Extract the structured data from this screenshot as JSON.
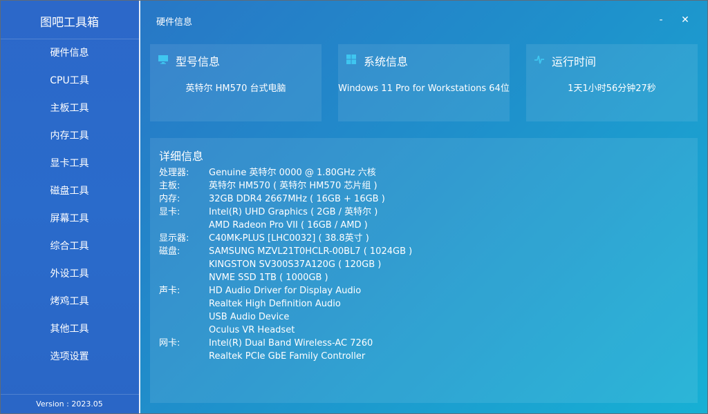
{
  "app": {
    "title": "图吧工具箱",
    "version": "Version : 2023.05"
  },
  "sidebar": {
    "items": [
      {
        "label": "硬件信息"
      },
      {
        "label": "CPU工具"
      },
      {
        "label": "主板工具"
      },
      {
        "label": "内存工具"
      },
      {
        "label": "显卡工具"
      },
      {
        "label": "磁盘工具"
      },
      {
        "label": "屏幕工具"
      },
      {
        "label": "综合工具"
      },
      {
        "label": "外设工具"
      },
      {
        "label": "烤鸡工具"
      },
      {
        "label": "其他工具"
      },
      {
        "label": "选项设置"
      }
    ]
  },
  "titlebar": {
    "page": "硬件信息",
    "minimize": "-",
    "close": "✕"
  },
  "cards": {
    "model": {
      "title": "型号信息",
      "value": "英特尔 HM570 台式电脑",
      "icon": "monitor-icon"
    },
    "system": {
      "title": "系统信息",
      "value": "Windows 11 Pro for Workstations 64位",
      "icon": "windows-icon"
    },
    "uptime": {
      "title": "运行时间",
      "value": "1天1小时56分钟27秒",
      "icon": "pulse-icon"
    }
  },
  "detail": {
    "title": "详细信息",
    "rows": [
      {
        "label": "处理器:",
        "values": [
          "Genuine 英特尔 0000 @ 1.80GHz 六核"
        ]
      },
      {
        "label": "主板:",
        "values": [
          "英特尔 HM570 ( 英特尔 HM570 芯片组 )"
        ]
      },
      {
        "label": "内存:",
        "values": [
          "32GB DDR4 2667MHz ( 16GB + 16GB )"
        ]
      },
      {
        "label": "显卡:",
        "values": [
          "Intel(R) UHD Graphics ( 2GB / 英特尔 )",
          "AMD Radeon Pro VII ( 16GB / AMD )"
        ]
      },
      {
        "label": "显示器:",
        "values": [
          "C40MK-PLUS [LHC0032] ( 38.8英寸 )"
        ]
      },
      {
        "label": "磁盘:",
        "values": [
          "SAMSUNG MZVL21T0HCLR-00BL7 ( 1024GB )",
          "KINGSTON SV300S37A120G ( 120GB )",
          "NVME SSD 1TB ( 1000GB )"
        ]
      },
      {
        "label": "声卡:",
        "values": [
          "HD Audio Driver for Display Audio",
          "Realtek High Definition Audio",
          "USB Audio Device",
          "Oculus VR Headset"
        ]
      },
      {
        "label": "网卡:",
        "values": [
          "Intel(R) Dual Band Wireless-AC 7260",
          "Realtek PCIe GbE Family Controller"
        ]
      }
    ]
  },
  "colors": {
    "sidebar": "#2a6bcb",
    "main_start": "#2877c6",
    "main_end": "#17b0d4",
    "icon_accent": "#3fc6f0"
  }
}
